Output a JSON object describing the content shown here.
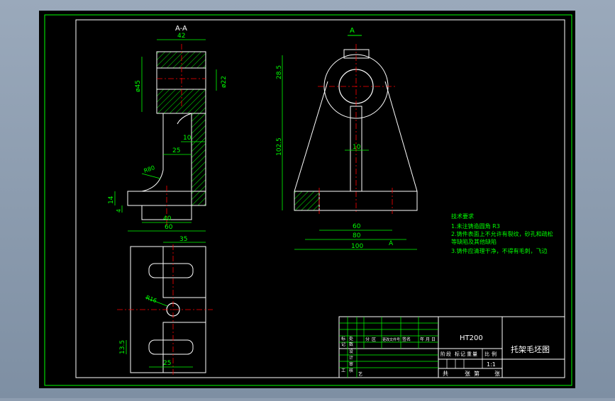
{
  "colors": {
    "background": "#000000",
    "frame": "#00ff00",
    "outline": "#ffffff",
    "centerline": "#ff0000",
    "dimension": "#00ff00",
    "hatch": "#00ff00",
    "chrome": "#8e9db0"
  },
  "section_view": {
    "title": "A-A",
    "dims": {
      "top_width": "42",
      "left_dia": "ø45",
      "right_dia": "ø22",
      "rib": "10",
      "inner": "25",
      "radius": "R80",
      "height": "14",
      "step": "4",
      "base_inner": "40",
      "base_width": "60"
    }
  },
  "front_view": {
    "section_mark_top": "A",
    "section_mark_bottom": "A",
    "dims": {
      "top_height": "28.5",
      "center_height": "102.5",
      "rib": "10",
      "base_60": "60",
      "base_80": "80",
      "base_100": "100"
    }
  },
  "top_view": {
    "dims": {
      "top": "35",
      "hole": "R16",
      "slot": "13.5",
      "bottom": "25"
    }
  },
  "notes": {
    "heading": "技术要求",
    "lines": [
      "1.未注铸造圆角 R3",
      "2.铸件表面上不允许有裂纹，砂孔和疏松",
      "  等缺陷及其他缺陷",
      "3.铸件应清理干净，不得有毛刺，飞边"
    ]
  },
  "title_block": {
    "material": "HT200",
    "drawing_name": "托架毛坯图",
    "scale": "1:1",
    "header_labels": [
      "阶",
      "段",
      "标",
      "记",
      "重",
      "量",
      "比",
      "例"
    ],
    "left_labels": [
      "标",
      "记",
      "处",
      "数",
      "设",
      "计",
      "审",
      "核",
      "工",
      "艺"
    ],
    "row_labels": [
      "分",
      "区",
      "更改文件号",
      "签名",
      "年",
      "月",
      "日"
    ],
    "sheet_labels": [
      "共",
      "张",
      "第",
      "张"
    ]
  }
}
